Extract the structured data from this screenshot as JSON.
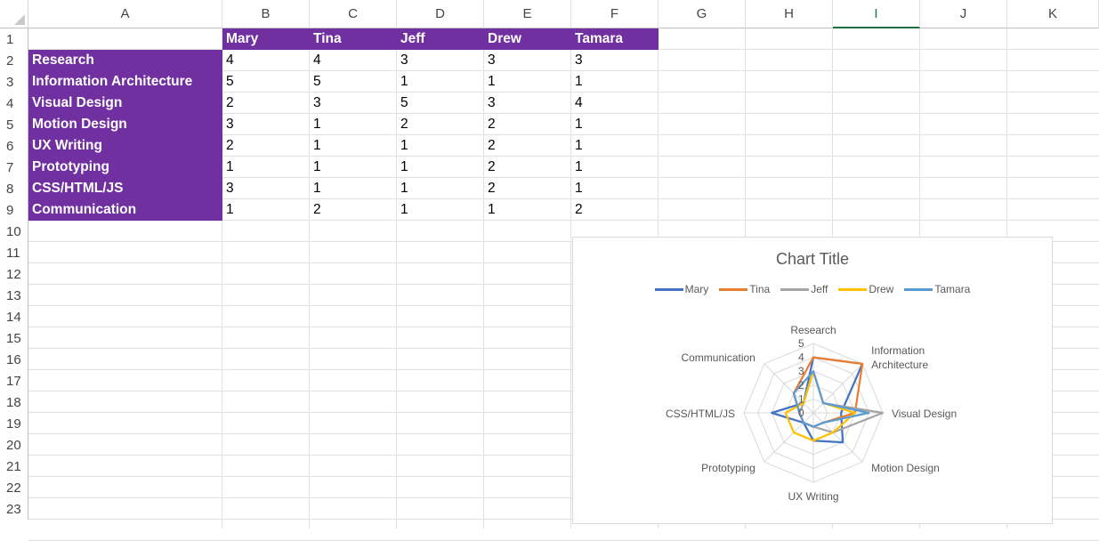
{
  "columns": [
    "A",
    "B",
    "C",
    "D",
    "E",
    "F",
    "G",
    "H",
    "I",
    "J",
    "K"
  ],
  "selected_column": "I",
  "rows": [
    "1",
    "2",
    "3",
    "4",
    "5",
    "6",
    "7",
    "8",
    "9",
    "10",
    "11",
    "12",
    "13",
    "14",
    "15",
    "16",
    "17",
    "18",
    "19",
    "20",
    "21",
    "22",
    "23"
  ],
  "sheet": {
    "header_row": [
      "",
      "Mary",
      "Tina",
      "Jeff",
      "Drew",
      "Tamara"
    ],
    "data_rows": [
      {
        "label": "Research",
        "values": [
          "4",
          "4",
          "3",
          "3",
          "3"
        ]
      },
      {
        "label": "Information Architecture",
        "values": [
          "5",
          "5",
          "1",
          "1",
          "1"
        ]
      },
      {
        "label": "Visual Design",
        "values": [
          "2",
          "3",
          "5",
          "3",
          "4"
        ]
      },
      {
        "label": "Motion Design",
        "values": [
          "3",
          "1",
          "2",
          "2",
          "1"
        ]
      },
      {
        "label": "UX Writing",
        "values": [
          "2",
          "1",
          "1",
          "2",
          "1"
        ]
      },
      {
        "label": "Prototyping",
        "values": [
          "1",
          "1",
          "1",
          "2",
          "1"
        ]
      },
      {
        "label": "CSS/HTML/JS",
        "values": [
          "3",
          "1",
          "1",
          "2",
          "1"
        ]
      },
      {
        "label": "Communication",
        "values": [
          "1",
          "2",
          "1",
          "1",
          "2"
        ]
      }
    ]
  },
  "chart_data": {
    "type": "radar",
    "title": "Chart Title",
    "categories": [
      "Research",
      "Information Architecture",
      "Visual Design",
      "Motion Design",
      "UX Writing",
      "Prototyping",
      "CSS/HTML/JS",
      "Communication"
    ],
    "category_display": [
      "Research",
      "Information\nArchitecture",
      "Visual Design",
      "Motion Design",
      "UX Writing",
      "Prototyping",
      "CSS/HTML/JS",
      "Communication"
    ],
    "ticks": [
      "0",
      "1",
      "2",
      "3",
      "4",
      "5"
    ],
    "rmax": 5,
    "legend_position": "top",
    "series": [
      {
        "name": "Mary",
        "color": "#4472c4",
        "values": [
          4,
          5,
          2,
          3,
          2,
          1,
          3,
          1
        ]
      },
      {
        "name": "Tina",
        "color": "#ed7d31",
        "values": [
          4,
          5,
          3,
          1,
          1,
          1,
          1,
          2
        ]
      },
      {
        "name": "Jeff",
        "color": "#a5a5a5",
        "values": [
          3,
          1,
          5,
          2,
          1,
          1,
          1,
          1
        ]
      },
      {
        "name": "Drew",
        "color": "#ffc000",
        "values": [
          3,
          1,
          3,
          2,
          2,
          2,
          2,
          1
        ]
      },
      {
        "name": "Tamara",
        "color": "#5b9bd5",
        "values": [
          3,
          1,
          4,
          1,
          1,
          1,
          1,
          2
        ]
      }
    ]
  }
}
